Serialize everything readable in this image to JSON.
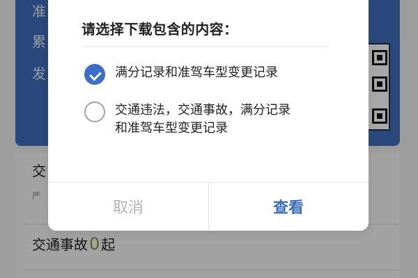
{
  "background": {
    "left_labels": [
      "准",
      "累",
      "发"
    ],
    "row1_label": "交",
    "row1_sub": "严",
    "row2_label": "交通事故",
    "row2_count": "0",
    "row2_unit": "起"
  },
  "dialog": {
    "title": "请选择下载包含的内容：",
    "options": [
      {
        "label": "满分记录和准驾车型变更记录",
        "checked": true
      },
      {
        "label": "交通违法，交通事故，满分记录\n和准驾车型变更记录",
        "checked": false
      }
    ],
    "buttons": {
      "cancel": "取消",
      "view": "查看"
    }
  },
  "colors": {
    "accent": "#3b6fc8",
    "app_blue": "#3f6fbe",
    "green_count": "#7fa033"
  }
}
